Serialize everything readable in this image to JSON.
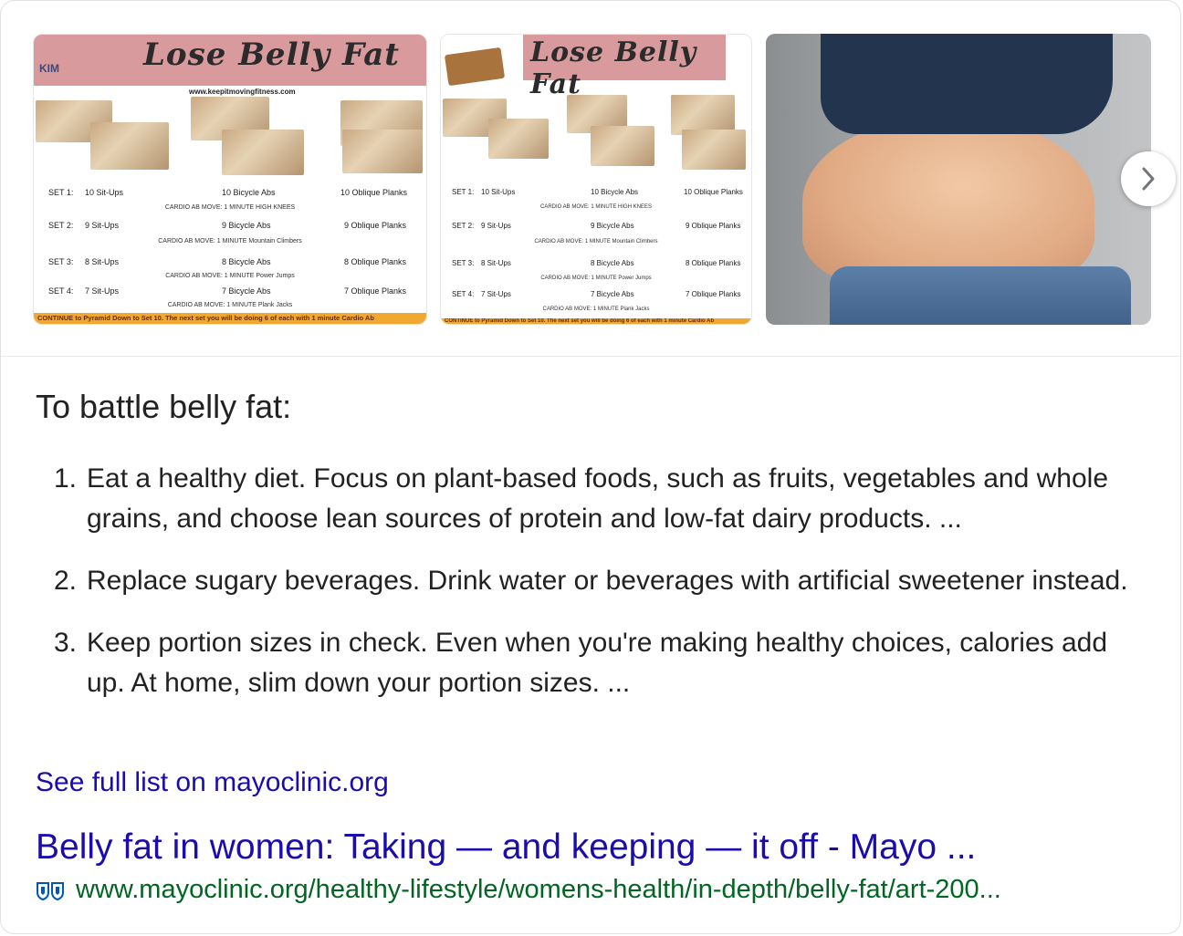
{
  "images": {
    "poster_title": "Lose Belly Fat",
    "poster_url": "www.keepitmovingfitness.com",
    "poster_logo": "KIM",
    "sets": [
      {
        "set": "SET 1:",
        "situps": "10 Sit-Ups",
        "bicycle": "10 Bicycle Abs",
        "planks": "10 Oblique Planks",
        "cardio": "CARDIO AB MOVE: 1 MINUTE  HIGH KNEES"
      },
      {
        "set": "SET 2:",
        "situps": "9 Sit-Ups",
        "bicycle": "9 Bicycle Abs",
        "planks": "9 Oblique Planks",
        "cardio": "CARDIO AB MOVE: 1 MINUTE  Mountain Climbers"
      },
      {
        "set": "SET 3:",
        "situps": "8 Sit-Ups",
        "bicycle": "8 Bicycle Abs",
        "planks": "8 Oblique Planks",
        "cardio": "CARDIO AB MOVE: 1 MINUTE  Power Jumps"
      },
      {
        "set": "SET 4:",
        "situps": "7 Sit-Ups",
        "bicycle": "7 Bicycle Abs",
        "planks": "7 Oblique Planks",
        "cardio": "CARDIO AB MOVE: 1 MINUTE  Plank Jacks"
      }
    ],
    "footer": "CONTINUE to Pyramid Down to Set 10. The next set you will be doing 6 of each with 1 minute Cardio Ab"
  },
  "snippet": {
    "heading": "To battle belly fat:",
    "items": [
      {
        "num": "1.",
        "text": "Eat a healthy diet. Focus on plant-based foods, such as fruits, vegetables and whole grains, and choose lean sources of protein and low-fat dairy products. ..."
      },
      {
        "num": "2.",
        "text": "Replace sugary beverages. Drink water or beverages with artificial sweetener instead."
      },
      {
        "num": "3.",
        "text": "Keep portion sizes in check. Even when you're making healthy choices, calories add up. At home, slim down your portion sizes. ..."
      }
    ],
    "see_full_link": "See full list on mayoclinic.org"
  },
  "result": {
    "title": "Belly fat in women: Taking — and keeping — it off - Mayo ...",
    "url": "www.mayoclinic.org/healthy-lifestyle/womens-health/in-depth/belly-fat/art-200..."
  },
  "icons": {
    "next": "chevron-right-icon",
    "favicon": "mayo-clinic-shield-icon"
  },
  "colors": {
    "link": "#1a0dab",
    "url_green": "#006621",
    "poster_pink": "#d99a9e",
    "poster_orange": "#f0a830"
  }
}
